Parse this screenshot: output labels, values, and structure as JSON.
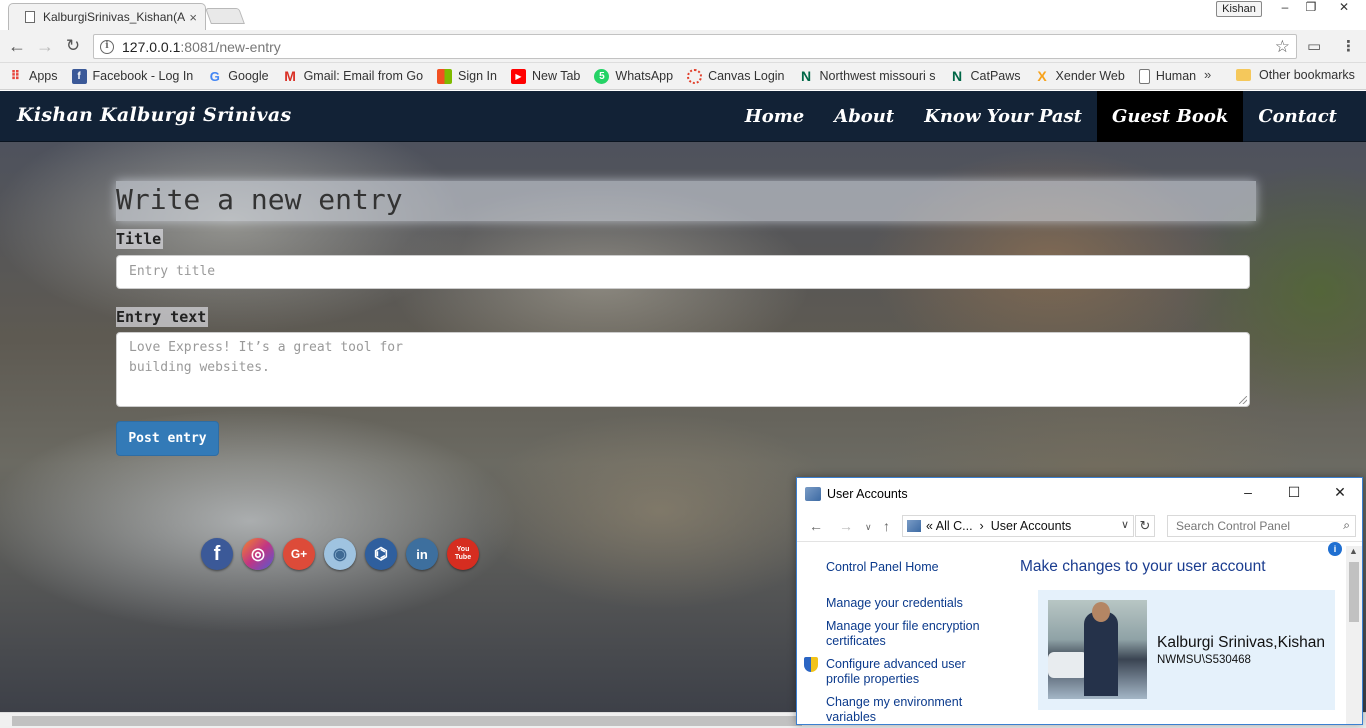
{
  "browser": {
    "tab_title": "KalburgiSrinivas_Kishan(A",
    "tab_close": "×",
    "profile": "Kishan",
    "window_controls": [
      "–",
      "❐",
      "✕"
    ],
    "url_host": "127.0.0.1",
    "url_path": ":8081/new-entry",
    "bookmarks": [
      {
        "label": "Apps",
        "icon": "apps-grid-icon",
        "color": "#e8453c"
      },
      {
        "label": "Facebook - Log In",
        "icon": "facebook-icon",
        "color": "#3b5998"
      },
      {
        "label": "Google",
        "icon": "google-icon",
        "color": "#4285f4"
      },
      {
        "label": "Gmail: Email from Go",
        "icon": "gmail-icon",
        "color": "#d93025"
      },
      {
        "label": "Sign In",
        "icon": "windows-icon",
        "color": "#f25022"
      },
      {
        "label": "New Tab",
        "icon": "youtube-icon",
        "color": "#ff0000"
      },
      {
        "label": "WhatsApp",
        "icon": "whatsapp-icon",
        "color": "#25d366"
      },
      {
        "label": "Canvas Login",
        "icon": "canvas-icon",
        "color": "#e13f2b"
      },
      {
        "label": "Northwest missouri s",
        "icon": "northwest-icon",
        "color": "#006747"
      },
      {
        "label": "CatPaws",
        "icon": "northwest-icon",
        "color": "#006747"
      },
      {
        "label": "Xender Web",
        "icon": "xender-icon",
        "color": "#f7a21b"
      },
      {
        "label": "Human",
        "icon": "page-icon",
        "color": "#777777"
      }
    ],
    "bookmarks_more": "»",
    "other_bookmarks": "Other bookmarks"
  },
  "site": {
    "brand": "Kishan Kalburgi Srinivas",
    "nav": [
      {
        "label": "Home",
        "active": false
      },
      {
        "label": "About",
        "active": false
      },
      {
        "label": "Know Your Past",
        "active": false
      },
      {
        "label": "Guest Book",
        "active": true
      },
      {
        "label": "Contact",
        "active": false
      }
    ],
    "form": {
      "heading": "Write a new entry",
      "title_label": "Title",
      "title_placeholder": "Entry title",
      "text_label": "Entry text",
      "text_placeholder_line1": "Love Express! It’s a great tool for",
      "text_placeholder_line2": "building websites.",
      "submit": "Post entry"
    },
    "socials": [
      {
        "name": "facebook",
        "glyph": "f",
        "color": "#3b5998"
      },
      {
        "name": "instagram",
        "glyph": "◎",
        "color": "#c13584"
      },
      {
        "name": "google-plus",
        "glyph": "G+",
        "color": "#dd4b39"
      },
      {
        "name": "bucket",
        "glyph": "◉",
        "color": "#7fa7c9"
      },
      {
        "name": "github",
        "glyph": "⌬",
        "color": "#2f5f9e"
      },
      {
        "name": "linkedin",
        "glyph": "in",
        "color": "#3d6f9e"
      },
      {
        "name": "youtube",
        "glyph": "You Tube",
        "color": "#d62d20"
      }
    ]
  },
  "user_accounts": {
    "title": "User Accounts",
    "breadcrumb_prefix": "« All C...",
    "breadcrumb_sep": "›",
    "breadcrumb_current": "User Accounts",
    "search_placeholder": "Search Control Panel",
    "side_links": [
      "Control Panel Home",
      "Manage your credentials",
      "Manage your file encryption certificates",
      "Configure advanced user profile properties",
      "Change my environment variables"
    ],
    "heading": "Make changes to your user account",
    "display_name": "Kalburgi Srinivas,Kishan",
    "account": "NWMSU\\S530468"
  }
}
